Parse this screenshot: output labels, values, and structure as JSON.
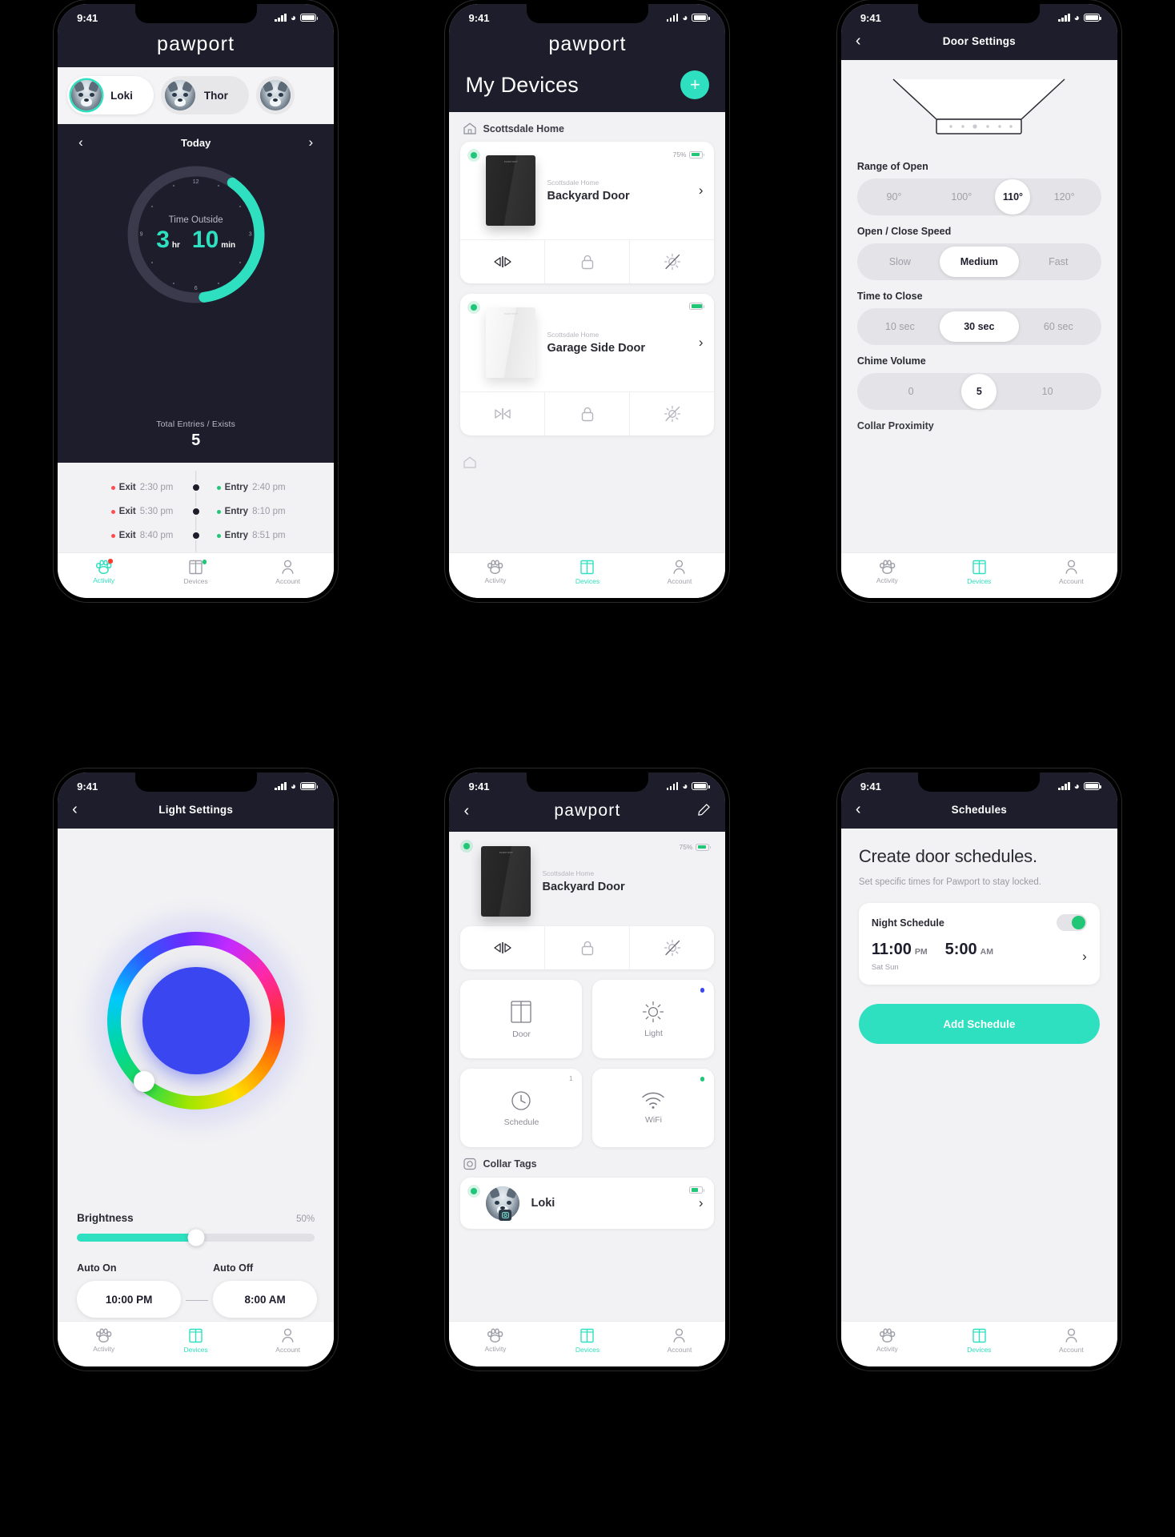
{
  "status_bar": {
    "time": "9:41"
  },
  "brand": {
    "wordmark": "pawport",
    "accent": "#2ee0bf"
  },
  "screen1_activity": {
    "pets": [
      {
        "name": "Loki",
        "selected": true
      },
      {
        "name": "Thor",
        "selected": false
      },
      {
        "name": "",
        "selected": false
      }
    ],
    "day_label": "Today",
    "prev_arrow": "‹",
    "next_arrow": "›",
    "dial": {
      "caption": "Time Outside",
      "hours": "3",
      "hours_unit": "hr",
      "minutes": "10",
      "minutes_unit": "min",
      "ticks": [
        "12",
        "3",
        "6",
        "9"
      ],
      "progress_pct": 38
    },
    "totals": {
      "label": "Total Entries / Exists",
      "value": "5"
    },
    "timeline": [
      {
        "exit_label": "Exit",
        "exit_time": "2:30 pm",
        "entry_label": "Entry",
        "entry_time": "2:40 pm"
      },
      {
        "exit_label": "Exit",
        "exit_time": "5:30 pm",
        "entry_label": "Entry",
        "entry_time": "8:10 pm"
      },
      {
        "exit_label": "Exit",
        "exit_time": "8:40 pm",
        "entry_label": "Entry",
        "entry_time": "8:51 pm"
      }
    ],
    "tabs": [
      {
        "label": "Activity",
        "icon": "paw-icon",
        "active": true,
        "badge": "red"
      },
      {
        "label": "Devices",
        "icon": "door-icon",
        "active": false,
        "badge": "green"
      },
      {
        "label": "Account",
        "icon": "person-icon",
        "active": false,
        "badge": ""
      }
    ]
  },
  "screen2_devices": {
    "title": "My Devices",
    "add_label": "+",
    "home_section": {
      "icon": "home-icon",
      "name": "Scottsdale Home"
    },
    "devices": [
      {
        "location": "Scottsdale Home",
        "name": "Backyard Door",
        "battery_pct": "75%",
        "battery_level": 75,
        "online": true,
        "chevron": "›",
        "actions": [
          "door-open-close-icon",
          "lock-icon",
          "light-off-icon"
        ],
        "style": "dark"
      },
      {
        "location": "Scottsdale Home",
        "name": "Garage Side Door",
        "battery_pct": "",
        "battery_level": 95,
        "online": true,
        "chevron": "›",
        "actions": [
          "door-close-open-icon",
          "lock-icon",
          "light-off-icon"
        ],
        "style": "light"
      }
    ],
    "tabs": [
      {
        "label": "Activity",
        "icon": "paw-icon",
        "active": false
      },
      {
        "label": "Devices",
        "icon": "door-icon",
        "active": true
      },
      {
        "label": "Account",
        "icon": "person-icon",
        "active": false
      }
    ]
  },
  "screen3_door_settings": {
    "title": "Door Settings",
    "back": "‹",
    "settings": [
      {
        "label": "Range of Open",
        "options": [
          "90°",
          "100°",
          "110°",
          "120°"
        ],
        "selected": "110°",
        "shape": "round"
      },
      {
        "label": "Open / Close Speed",
        "options": [
          "Slow",
          "Medium",
          "Fast"
        ],
        "selected": "Medium",
        "shape": "pill"
      },
      {
        "label": "Time to Close",
        "options": [
          "10 sec",
          "30 sec",
          "60 sec"
        ],
        "selected": "30 sec",
        "shape": "pill"
      },
      {
        "label": "Chime Volume",
        "options": [
          "0",
          "5",
          "10"
        ],
        "selected": "5",
        "shape": "round"
      }
    ],
    "cut_off_label": "Collar Proximity",
    "tabs": [
      {
        "label": "Activity",
        "icon": "paw-icon",
        "active": false
      },
      {
        "label": "Devices",
        "icon": "door-icon",
        "active": true
      },
      {
        "label": "Account",
        "icon": "person-icon",
        "active": false
      }
    ]
  },
  "screen4_light_settings": {
    "title": "Light Settings",
    "back": "‹",
    "color_wheel": {
      "selected_color": "#3a46f0"
    },
    "brightness": {
      "label": "Brightness",
      "value": "50%",
      "value_pct": 50
    },
    "auto_on": {
      "label": "Auto On",
      "value": "10:00 PM"
    },
    "auto_off": {
      "label": "Auto Off",
      "value": "8:00 AM"
    },
    "separator": "—",
    "tabs": [
      {
        "label": "Activity",
        "icon": "paw-icon",
        "active": false
      },
      {
        "label": "Devices",
        "icon": "door-icon",
        "active": true
      },
      {
        "label": "Account",
        "icon": "person-icon",
        "active": false
      }
    ]
  },
  "screen5_device_detail": {
    "wordmark": "pawport",
    "back": "‹",
    "edit_icon": "pencil-icon",
    "device": {
      "location": "Scottsdale Home",
      "name": "Backyard Door",
      "battery_pct": "75%",
      "battery_level": 75,
      "online": true
    },
    "row_actions": [
      "door-open-close-icon",
      "lock-icon",
      "light-off-icon"
    ],
    "tiles": [
      {
        "label": "Door",
        "icon": "door-panel-icon",
        "corner": "",
        "corner_dot": ""
      },
      {
        "label": "Light",
        "icon": "light-off-icon",
        "corner": "",
        "corner_dot": "#3a46f0"
      },
      {
        "label": "Schedule",
        "icon": "clock-icon",
        "corner": "1",
        "corner_dot": ""
      },
      {
        "label": "WiFi",
        "icon": "wifi-icon",
        "corner": "",
        "corner_dot": "#21c776"
      }
    ],
    "collar_section": {
      "icon": "tag-icon",
      "name": "Collar Tags"
    },
    "collars": [
      {
        "name": "Loki",
        "battery_level": 60,
        "online": true,
        "chevron": "›"
      }
    ],
    "tabs": [
      {
        "label": "Activity",
        "icon": "paw-icon",
        "active": false
      },
      {
        "label": "Devices",
        "icon": "door-icon",
        "active": true
      },
      {
        "label": "Account",
        "icon": "person-icon",
        "active": false
      }
    ]
  },
  "screen6_schedules": {
    "title": "Schedules",
    "back": "‹",
    "heading": "Create door schedules.",
    "subheading": "Set specific times for Pawport to stay locked.",
    "schedule": {
      "name": "Night Schedule",
      "enabled": true,
      "start_hour": "11:00",
      "start_meridiem": "PM",
      "end_hour": "5:00",
      "end_meridiem": "AM",
      "days": "Sat Sun",
      "chevron": "›"
    },
    "add_button": "Add Schedule",
    "tabs": [
      {
        "label": "Activity",
        "icon": "paw-icon",
        "active": false
      },
      {
        "label": "Devices",
        "icon": "door-icon",
        "active": true
      },
      {
        "label": "Account",
        "icon": "person-icon",
        "active": false
      }
    ]
  }
}
